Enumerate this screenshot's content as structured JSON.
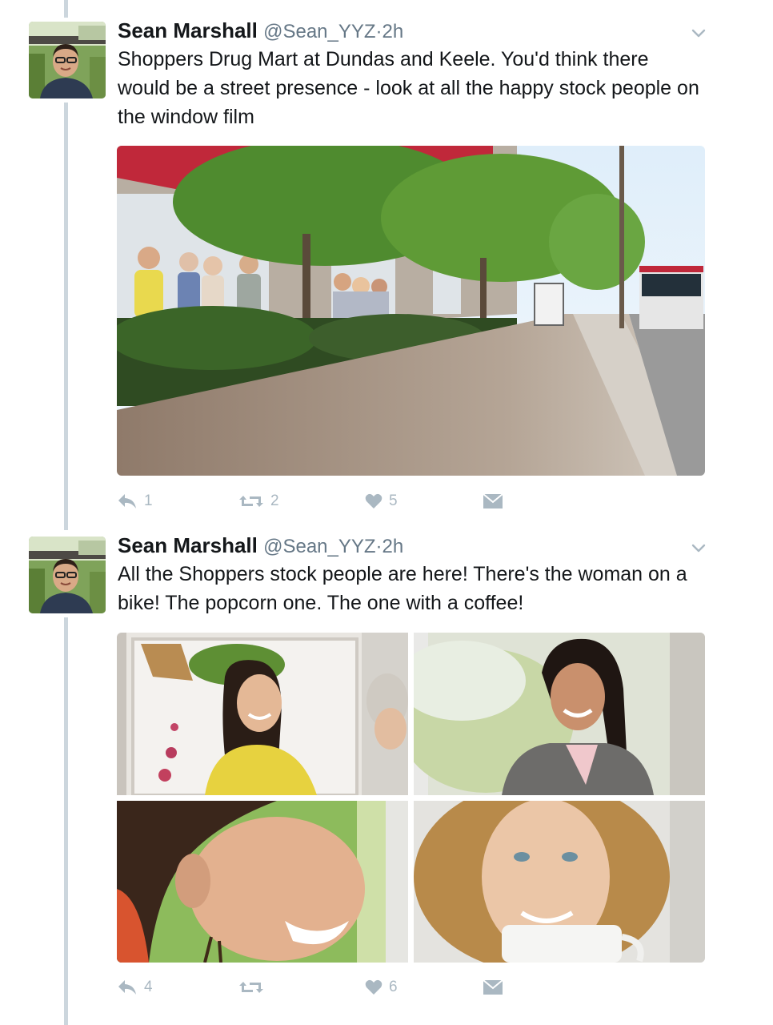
{
  "tweets": [
    {
      "author": {
        "name": "Sean Marshall",
        "handle": "@Sean_YYZ",
        "time": "2h"
      },
      "separator": "·",
      "text": "Shoppers Drug Mart at Dundas and Keele. You'd think there would be a street presence - look at all the happy stock people on the window film",
      "media": {
        "kind": "single-photo",
        "description": "storefront-street-photo"
      },
      "actions": {
        "reply_count": "1",
        "retweet_count": "2",
        "like_count": "5"
      }
    },
    {
      "author": {
        "name": "Sean Marshall",
        "handle": "@Sean_YYZ",
        "time": "2h"
      },
      "separator": "·",
      "text": "All the Shoppers stock people are here! There's the woman on a bike! The popcorn one. The one with a coffee!",
      "media": {
        "kind": "photo-grid",
        "count": 4
      },
      "actions": {
        "reply_count": "4",
        "retweet_count": "",
        "like_count": "6"
      }
    }
  ],
  "icons": {
    "reply": "reply-icon",
    "retweet": "retweet-icon",
    "like": "heart-icon",
    "dm": "envelope-icon",
    "menu": "chevron-down-icon"
  },
  "colors": {
    "text": "#14171a",
    "muted": "#657786",
    "icon": "#aab8c2",
    "thread": "#ccd6dd"
  }
}
